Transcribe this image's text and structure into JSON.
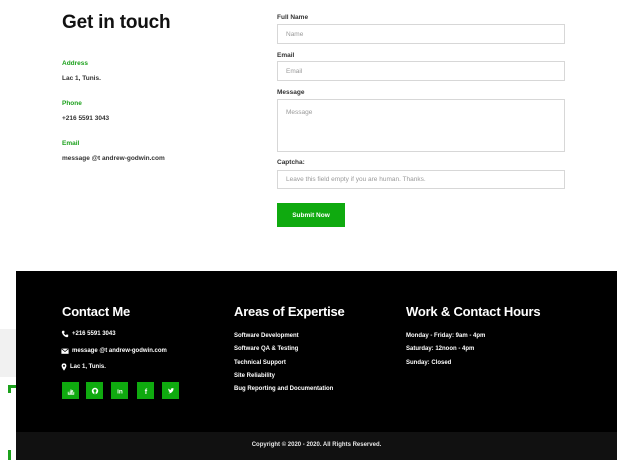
{
  "contact": {
    "title": "Get in touch",
    "address_label": "Address",
    "address_value": "Lac 1, Tunis.",
    "phone_label": "Phone",
    "phone_value": "+216 5591 3043",
    "email_label": "Email",
    "email_value": "message @t andrew-godwin.com"
  },
  "form": {
    "fullname_label": "Full Name",
    "fullname_placeholder": "Name",
    "email_label": "Email",
    "email_placeholder": "Email",
    "message_label": "Message",
    "message_placeholder": "Message",
    "captcha_label": "Captcha:",
    "captcha_placeholder": "Leave this field empty if you are human. Thanks.",
    "submit_label": "Submit Now"
  },
  "footer": {
    "contact_heading": "Contact Me",
    "phone": "+216 5591 3043",
    "email": "message @t andrew-godwin.com",
    "location": "Lac 1, Tunis.",
    "social_icons": [
      "stackoverflow-icon",
      "github-icon",
      "linkedin-icon",
      "facebook-icon",
      "twitter-icon"
    ],
    "expertise_heading": "Areas of Expertise",
    "expertise": [
      "Software Development",
      "Software QA & Testing",
      "Technical Support",
      "Site Reliability",
      "Bug Reporting and Documentation"
    ],
    "hours_heading": "Work & Contact Hours",
    "hours": [
      "Monday - Friday: 9am - 4pm",
      "Saturday: 12noon - 4pm",
      "Sunday: Closed"
    ],
    "copyright": "Copyright © 2020 - 2020. All Rights Reserved."
  },
  "colors": {
    "accent": "#0faa0f",
    "footer_bg": "#000000",
    "label_green": "#1ca11c"
  }
}
